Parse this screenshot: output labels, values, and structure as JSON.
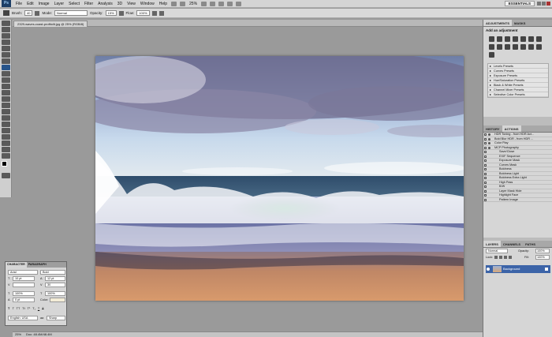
{
  "menu": {
    "logo": "Ps",
    "items": [
      "File",
      "Edit",
      "Image",
      "Layer",
      "Select",
      "Filter",
      "Analysis",
      "3D",
      "View",
      "Window",
      "Help"
    ],
    "zoom": "25%",
    "workspace": "ESSENTIALS"
  },
  "options": {
    "brush_label": "Brush:",
    "brush_size": "40",
    "mode_label": "Mode:",
    "mode": "Normal",
    "opacity_label": "Opacity:",
    "opacity": "15%",
    "flow_label": "Flow:",
    "flow": "100%"
  },
  "document": {
    "tab": "2329-waves-coast-profitolit.jpg @ 25% (RGB/8)",
    "zoom": "25%",
    "doc_size": "Doc: 48.4M/48.4M"
  },
  "adjustments": {
    "tabs": [
      "ADJUSTMENTS",
      "MASKS"
    ],
    "title": "Add an adjustment",
    "presets": [
      "Levels Presets",
      "Curves Presets",
      "Exposure Presets",
      "Hue/Saturation Presets",
      "Black & White Presets",
      "Channel Mixer Presets",
      "Selective Color Presets"
    ]
  },
  "actions": {
    "tabs": [
      "HISTORY",
      "ACTIONS"
    ],
    "items": [
      "HDR Toning - from HDR Act...",
      "Bold Blur HDR - from HDR ...",
      "Color Play",
      "MCP Photography",
      "Save/Close",
      "EXIF Sequence",
      "Exposure Mask",
      "Curves Mask",
      "Boldness",
      "Boldness Light",
      "Boldness Extra Light",
      "High Pass",
      "B/W",
      "Layer Mask Hide",
      "Highlight Face",
      "Pattern Image"
    ]
  },
  "layers": {
    "tabs": [
      "LAYERS",
      "CHANNELS",
      "PATHS"
    ],
    "blend": "Normal",
    "opacity_label": "Opacity:",
    "opacity": "100%",
    "lock_label": "Lock:",
    "fill_label": "Fill:",
    "fill": "100%",
    "layer_name": "Background"
  },
  "character": {
    "tabs": [
      "CHARACTER",
      "PARAGRAPH"
    ],
    "font": "Arial",
    "style": "Bold",
    "size": "10 pt",
    "leading": "12 pt",
    "tracking": "30",
    "vscale": "100%",
    "hscale": "100%",
    "baseline": "0 pt",
    "color_label": "Color:",
    "language": "English: USA",
    "aa": "Sharp"
  }
}
